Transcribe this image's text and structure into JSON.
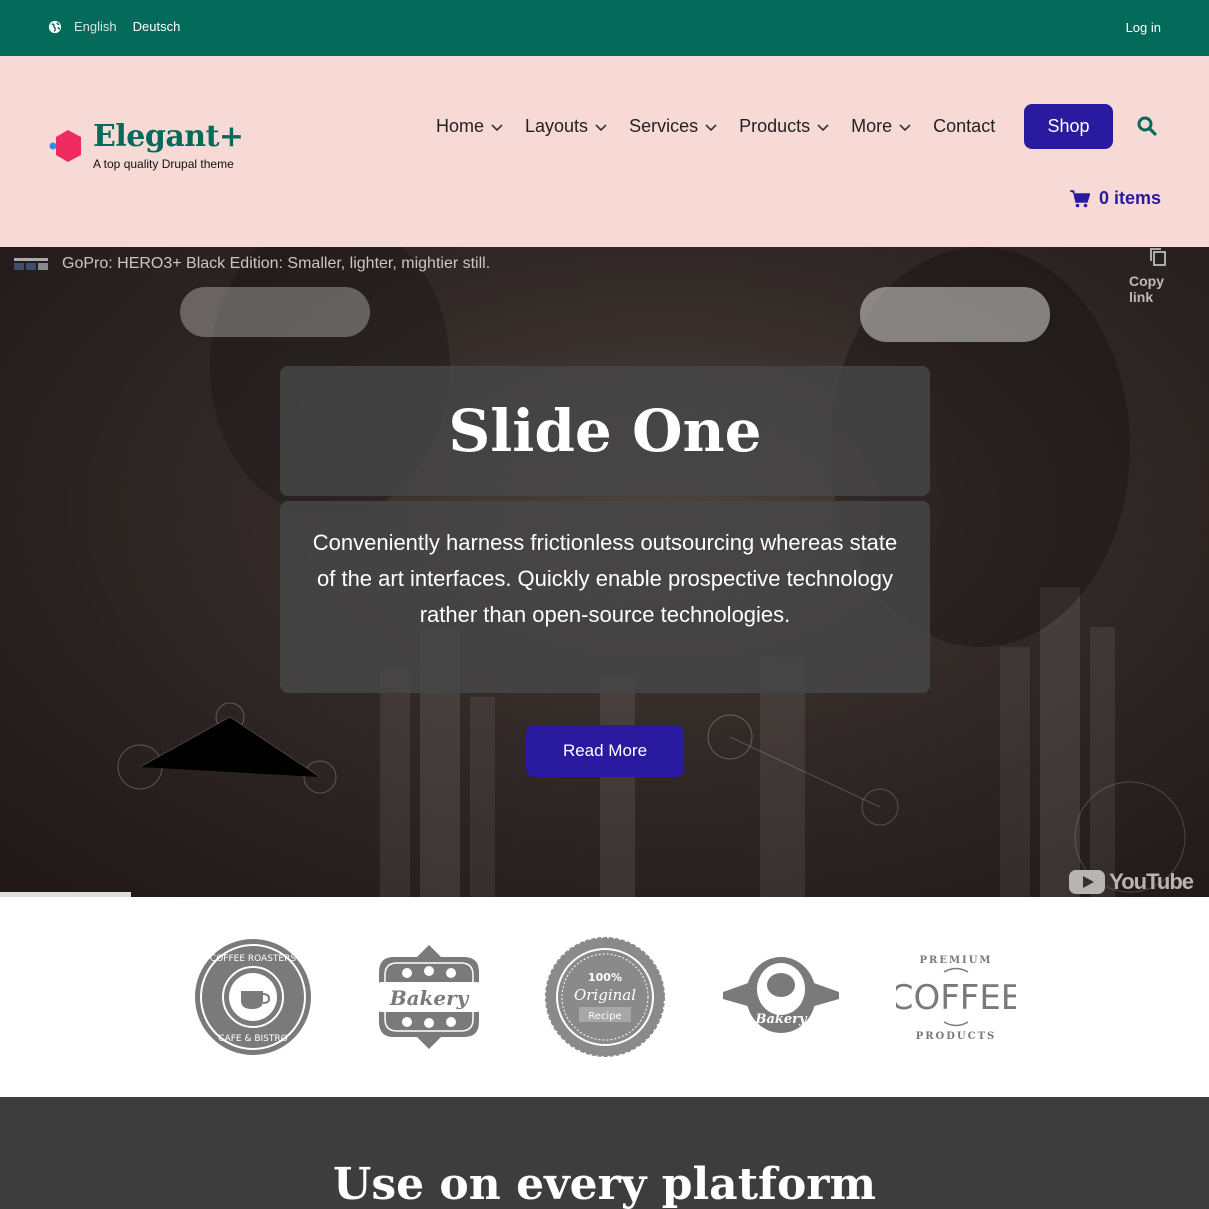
{
  "topbar": {
    "lang_english": "English",
    "lang_deutsch": "Deutsch",
    "login": "Log in",
    "bg_color": "#046a5a"
  },
  "header": {
    "site_name": "Elegant+",
    "slogan": "A top quality Drupal theme",
    "nav": [
      {
        "label": "Home",
        "has_dropdown": true
      },
      {
        "label": "Layouts",
        "has_dropdown": true
      },
      {
        "label": "Services",
        "has_dropdown": true
      },
      {
        "label": "Products",
        "has_dropdown": true
      },
      {
        "label": "More",
        "has_dropdown": true
      },
      {
        "label": "Contact",
        "has_dropdown": false
      }
    ],
    "shop": "Shop",
    "cart": "0 items",
    "bg_color": "#f7dad5",
    "accent_color": "#2a1aa0"
  },
  "hero": {
    "video_title": "GoPro: HERO3+ Black Edition: Smaller, lighter, mightier still.",
    "copy_link": "Copy link",
    "slide_title": "Slide One",
    "slide_text": "Conveniently harness frictionless outsourcing whereas state of the art interfaces. Quickly enable prospective technology rather than open-source technologies.",
    "read_more": "Read More",
    "youtube": "YouTube"
  },
  "logos": [
    {
      "name": "coffee-roasters-badge",
      "top": "COFFEE ROASTERS",
      "bottom": "CAFE & BISTRO"
    },
    {
      "name": "bakery-badge",
      "text": "Bakery"
    },
    {
      "name": "original-recipe-badge",
      "line1": "100%",
      "line2": "Original",
      "line3": "Recipe"
    },
    {
      "name": "bakery-ribbon-badge",
      "text": "Bakery"
    },
    {
      "name": "premium-coffee-badge",
      "top": "PREMIUM",
      "middle": "COFFEE",
      "bottom": "PRODUCTS"
    }
  ],
  "platform": {
    "title": "Use on every platform"
  }
}
